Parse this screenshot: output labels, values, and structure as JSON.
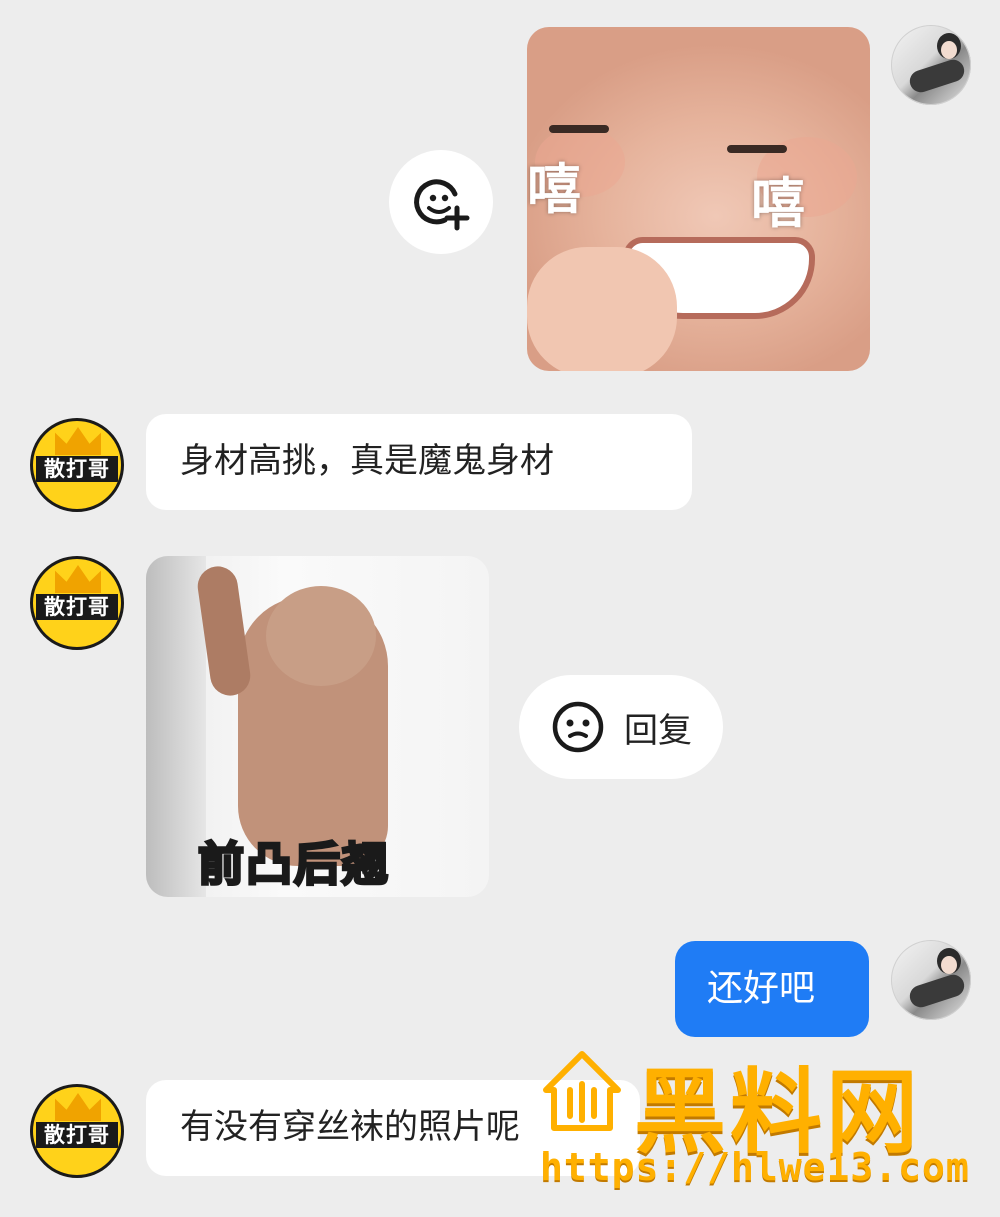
{
  "messages": {
    "m1_sticker_text_left": "嘻",
    "m1_sticker_text_right": "嘻",
    "m2_text": "身材高挑，真是魔鬼身材",
    "m3_sticker_caption": "前凸后翘",
    "m4_text": "还好吧",
    "m5_text": "有没有穿丝袜的照片呢"
  },
  "contact": {
    "avatar_name": "散打哥"
  },
  "actions": {
    "reply_label": "回复",
    "add_emoji_icon": "emoji-add-icon",
    "reply_icon": "smiley-icon"
  },
  "watermark": {
    "title": "黑料网",
    "url": "https://hlwe13.com"
  },
  "colors": {
    "background": "#ededed",
    "sent_bubble": "#1f7cf5",
    "received_bubble": "#ffffff",
    "watermark": "#ffb000"
  }
}
